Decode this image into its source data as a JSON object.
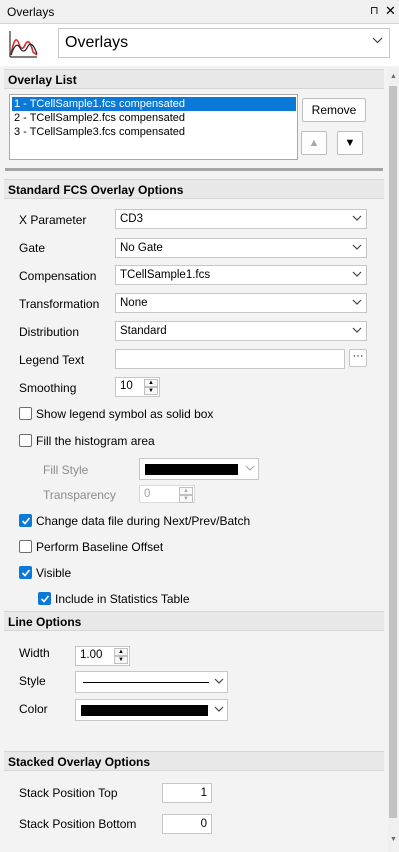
{
  "window": {
    "title": "Overlays",
    "pin_glyph": "⊓",
    "close_glyph": "✕"
  },
  "header": {
    "view_select": "Overlays",
    "logo_icon": "histogram-overlay-icon"
  },
  "overlay_list": {
    "title": "Overlay List",
    "items": [
      "1 - TCellSample1.fcs compensated",
      "2 - TCellSample2.fcs compensated",
      "3 - TCellSample3.fcs compensated"
    ],
    "selected_index": 0,
    "remove_label": "Remove",
    "up_glyph": "▲",
    "down_glyph": "▼"
  },
  "standard_options": {
    "title": "Standard FCS Overlay Options",
    "x_parameter": {
      "label": "X Parameter",
      "value": "CD3"
    },
    "gate": {
      "label": "Gate",
      "value": "No Gate"
    },
    "compensation": {
      "label": "Compensation",
      "value": "TCellSample1.fcs"
    },
    "transformation": {
      "label": "Transformation",
      "value": "None"
    },
    "distribution": {
      "label": "Distribution",
      "value": "Standard"
    },
    "legend_text": {
      "label": "Legend Text",
      "value": "",
      "browse_label": "···"
    },
    "smoothing": {
      "label": "Smoothing",
      "value": "10"
    },
    "show_legend_solid": {
      "label": "Show legend symbol as solid box",
      "checked": false
    },
    "fill_histogram": {
      "label": "Fill the histogram area",
      "checked": false
    },
    "fill_style": {
      "label": "Fill Style",
      "color": "#000000"
    },
    "transparency": {
      "label": "Transparency",
      "value": "0"
    },
    "change_data_file": {
      "label": "Change data file during Next/Prev/Batch",
      "checked": true
    },
    "baseline_offset": {
      "label": "Perform Baseline Offset",
      "checked": false
    },
    "visible": {
      "label": "Visible",
      "checked": true
    },
    "include_stats": {
      "label": "Include in Statistics Table",
      "checked": true
    }
  },
  "line_options": {
    "title": "Line Options",
    "width": {
      "label": "Width",
      "value": "1.00"
    },
    "style": {
      "label": "Style"
    },
    "color": {
      "label": "Color",
      "value": "#000000"
    }
  },
  "stacked_options": {
    "title": "Stacked Overlay Options",
    "top": {
      "label": "Stack Position Top",
      "value": "1"
    },
    "bottom": {
      "label": "Stack Position Bottom",
      "value": "0"
    }
  },
  "colors": {
    "accent": "#0a79d7",
    "section_bg": "#e8e8e8",
    "panel_bg": "#f3f3f3"
  }
}
